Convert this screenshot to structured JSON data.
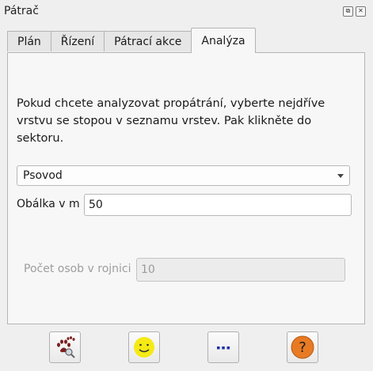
{
  "window": {
    "title": "Pátrač",
    "float_glyph": "⧉",
    "close_glyph": "✕"
  },
  "tabs": [
    {
      "label": "Plán",
      "active": false
    },
    {
      "label": "Řízení",
      "active": false
    },
    {
      "label": "Pátrací akce",
      "active": false
    },
    {
      "label": "Analýza",
      "active": true
    }
  ],
  "analysis": {
    "description": "Pokud chcete analyzovat propátrání, vyberte nejdříve vrstvu se stopou v seznamu vrstev. Pak klikněte do sektoru.",
    "layer_select_value": "Psovod",
    "envelope_label": "Obálka v m",
    "envelope_value": "50",
    "persons_label": "Počet osob v rojnici",
    "persons_placeholder": "10"
  },
  "toolbar": {
    "buttons": [
      {
        "icon": "paw-search-icon"
      },
      {
        "icon": "smiley-icon"
      },
      {
        "icon": "ellipsis-icon"
      },
      {
        "icon": "help-icon",
        "glyph": "?"
      }
    ]
  },
  "colors": {
    "paw": "#7a1f1f",
    "smiley": "#f5ea14",
    "ellipsis": "#1c2fa8",
    "help": "#e87a24"
  }
}
